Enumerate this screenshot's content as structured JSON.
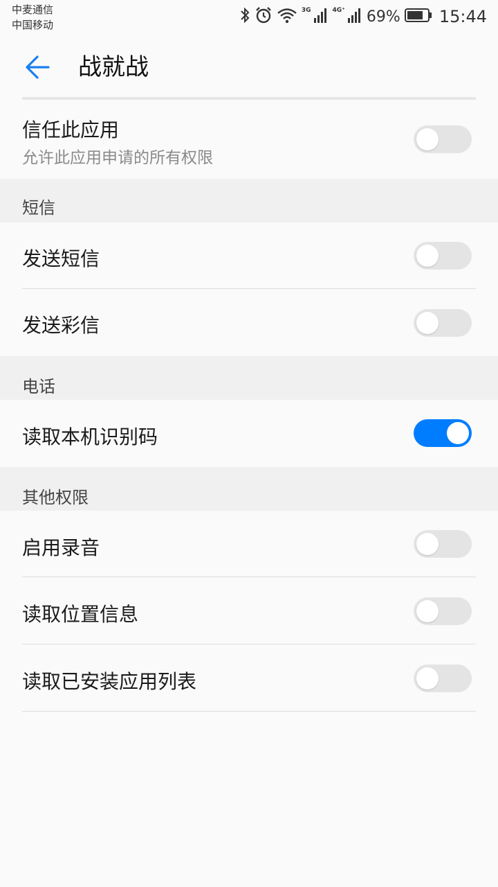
{
  "status_bar": {
    "carrier1": "中麦通信",
    "carrier2": "中国移动",
    "net1": "3G",
    "net2": "4G⁺",
    "battery": "69%",
    "time": "15:44",
    "icons": [
      "bluetooth-icon",
      "alarm-icon",
      "wifi-icon",
      "signal-icon",
      "signal-icon",
      "battery-icon"
    ]
  },
  "header": {
    "back_icon": "back-arrow-icon",
    "title": "战就战"
  },
  "trust": {
    "label": "信任此应用",
    "sublabel": "允许此应用申请的所有权限",
    "enabled": false
  },
  "sections": [
    {
      "title": "短信",
      "items": [
        {
          "label": "发送短信",
          "enabled": false
        },
        {
          "label": "发送彩信",
          "enabled": false
        }
      ]
    },
    {
      "title": "电话",
      "items": [
        {
          "label": "读取本机识别码",
          "enabled": true
        }
      ]
    },
    {
      "title": "其他权限",
      "items": [
        {
          "label": "启用录音",
          "enabled": false
        },
        {
          "label": "读取位置信息",
          "enabled": false
        },
        {
          "label": "读取已安装应用列表",
          "enabled": false
        }
      ]
    }
  ],
  "colors": {
    "accent": "#007dff",
    "toggle_off": "#e4e4e4",
    "section_bg": "#f0f0f0",
    "page_bg": "#fafafa"
  }
}
